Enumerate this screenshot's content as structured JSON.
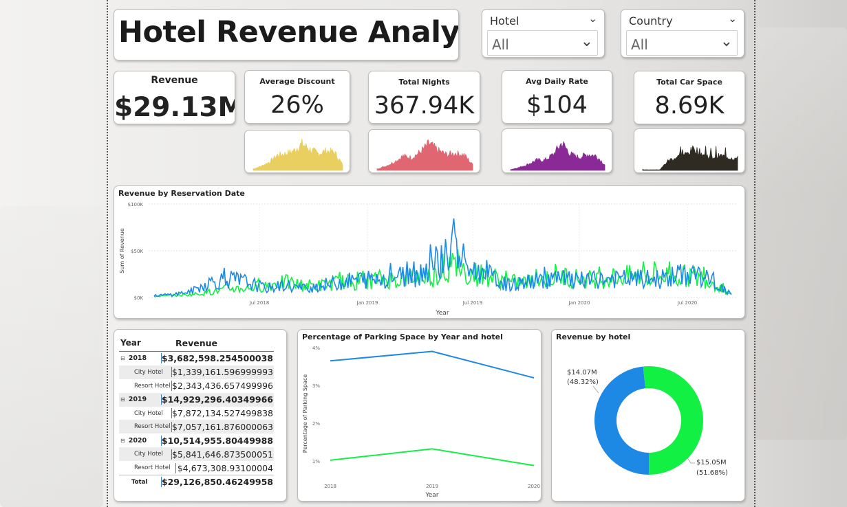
{
  "title": "Hotel Revenue Analysis",
  "slicers": {
    "hotel": {
      "label": "Hotel",
      "value": "All"
    },
    "country": {
      "label": "Country",
      "value": "All"
    }
  },
  "kpis": {
    "revenue": {
      "label": "Revenue",
      "value": "$29.13M"
    },
    "discount": {
      "label": "Average Discount",
      "value": "26%"
    },
    "nights": {
      "label": "Total Nights",
      "value": "367.94K"
    },
    "adr": {
      "label": "Avg Daily Rate",
      "value": "$104"
    },
    "car": {
      "label": "Total Car Space",
      "value": "8.69K"
    }
  },
  "colors": {
    "spark_discount": "#e9cf5f",
    "spark_nights": "#e06671",
    "spark_adr": "#8a2a96",
    "spark_car": "#2f2a22",
    "city_hotel": "#1e88e5",
    "resort_hotel": "#12f043"
  },
  "line_chart": {
    "title": "Revenue by Reservation Date",
    "ylabel": "Sum of Revenue",
    "xlabel": "Year",
    "yticks": [
      "$100K",
      "$50K",
      "$0K"
    ],
    "xticks": [
      "Jul 2018",
      "Jan 2019",
      "Jul 2019",
      "Jan 2020",
      "Jul 2020"
    ]
  },
  "matrix": {
    "col1": "Year",
    "col2": "Revenue",
    "rows": [
      {
        "label": "2018",
        "value": "$3,682,598.254500038"
      },
      {
        "label": "City Hotel",
        "value": "$1,339,161.596999993"
      },
      {
        "label": "Resort Hotel",
        "value": "$2,343,436.657499996"
      },
      {
        "label": "2019",
        "value": "$14,929,296.40349966"
      },
      {
        "label": "City Hotel",
        "value": "$7,872,134.527499838"
      },
      {
        "label": "Resort Hotel",
        "value": "$7,057,161.876000063"
      },
      {
        "label": "2020",
        "value": "$10,514,955.80449988"
      },
      {
        "label": "City Hotel",
        "value": "$5,841,646.873500051"
      },
      {
        "label": "Resort Hotel",
        "value": "$4,673,308.93100004"
      },
      {
        "label": "Total",
        "value": "$29,126,850.46249958"
      }
    ],
    "expand_icon": "⊟"
  },
  "parking_chart": {
    "title": "Percentage of Parking Space by Year and hotel",
    "ylabel": "Percentage of Parking Space",
    "xlabel": "Year",
    "yticks": [
      "4%",
      "3%",
      "2%",
      "1%"
    ],
    "xticks": [
      "2018",
      "2019",
      "2020"
    ]
  },
  "donut": {
    "title": "Revenue by hotel",
    "label_city": "$14.07M",
    "pct_city": "(48.32%)",
    "label_resort": "$15.05M",
    "pct_resort": "(51.68%)"
  },
  "chart_data": [
    {
      "type": "line",
      "title": "Percentage of Parking Space by Year and hotel",
      "xlabel": "Year",
      "ylabel": "Percentage of Parking Space",
      "categories": [
        "2018",
        "2019",
        "2020"
      ],
      "ylim": [
        0.7,
        4
      ],
      "series": [
        {
          "values": [
            3.65,
            3.9,
            3.2
          ]
        },
        {
          "values": [
            1.02,
            1.32,
            0.88
          ]
        }
      ]
    },
    {
      "type": "pie",
      "title": "Revenue by hotel",
      "categories": [
        "City Hotel",
        "Resort Hotel"
      ],
      "values": [
        14.07,
        15.05
      ],
      "percent": [
        48.32,
        51.68
      ]
    },
    {
      "type": "line",
      "title": "Revenue by Reservation Date",
      "xlabel": "Year",
      "ylabel": "Sum of Revenue",
      "x_range": [
        "2018-01",
        "2020-09"
      ],
      "ylim": [
        0,
        100000
      ],
      "series": [
        {
          "approx_monthly_peak_values": [
            3000,
            5000,
            10000,
            25000,
            30000,
            25000,
            15000,
            20000,
            15000,
            20000,
            25000,
            30000,
            30000,
            35000,
            35000,
            55000,
            80000,
            45000,
            35000,
            20000,
            25000,
            30000,
            30000,
            25000,
            30000,
            30000,
            30000,
            30000,
            35000,
            40000,
            25000,
            5000
          ]
        },
        {
          "approx_monthly_peak_values": [
            2000,
            3000,
            5000,
            8000,
            15000,
            15000,
            20000,
            25000,
            20000,
            20000,
            25000,
            25000,
            30000,
            30000,
            35000,
            35000,
            50000,
            40000,
            35000,
            25000,
            25000,
            30000,
            35000,
            30000,
            30000,
            35000,
            35000,
            35000,
            35000,
            35000,
            25000,
            5000
          ]
        }
      ]
    }
  ]
}
